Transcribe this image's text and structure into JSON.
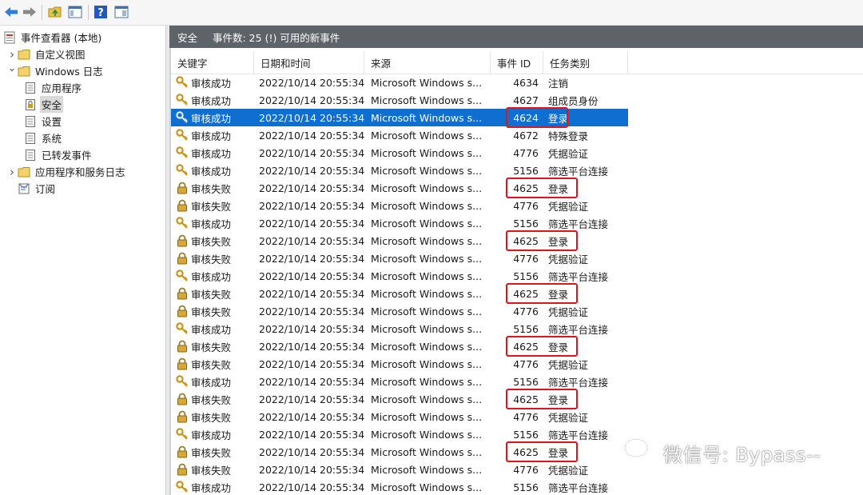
{
  "tree": {
    "root": "事件查看器 (本地)",
    "items": [
      {
        "label": "自定义视图",
        "level": 1,
        "chevron": "right"
      },
      {
        "label": "Windows 日志",
        "level": 1,
        "chevron": "down"
      },
      {
        "label": "应用程序",
        "level": 2
      },
      {
        "label": "安全",
        "level": 2,
        "selected": true
      },
      {
        "label": "设置",
        "level": 2
      },
      {
        "label": "系统",
        "level": 2
      },
      {
        "label": "已转发事件",
        "level": 2
      },
      {
        "label": "应用程序和服务日志",
        "level": 1,
        "chevron": "right"
      },
      {
        "label": "订阅",
        "level": 1
      }
    ]
  },
  "panel": {
    "title": "安全",
    "count_text": "事件数: 25 (!) 可用的新事件"
  },
  "columns": {
    "keyword": "关键字",
    "date": "日期和时间",
    "source": "来源",
    "event_id": "事件 ID",
    "task": "任务类别"
  },
  "rows": [
    {
      "kw": "审核成功",
      "icon": "key",
      "date": "2022/10/14 20:55:34",
      "src": "Microsoft Windows s...",
      "id": "4634",
      "task": "注销"
    },
    {
      "kw": "审核成功",
      "icon": "key",
      "date": "2022/10/14 20:55:34",
      "src": "Microsoft Windows s...",
      "id": "4627",
      "task": "组成员身份"
    },
    {
      "kw": "审核成功",
      "icon": "key",
      "date": "2022/10/14 20:55:34",
      "src": "Microsoft Windows s...",
      "id": "4624",
      "task": "登录",
      "selected": true,
      "highlight": true
    },
    {
      "kw": "审核成功",
      "icon": "key",
      "date": "2022/10/14 20:55:34",
      "src": "Microsoft Windows s...",
      "id": "4672",
      "task": "特殊登录"
    },
    {
      "kw": "审核成功",
      "icon": "key",
      "date": "2022/10/14 20:55:34",
      "src": "Microsoft Windows s...",
      "id": "4776",
      "task": "凭据验证"
    },
    {
      "kw": "审核成功",
      "icon": "key",
      "date": "2022/10/14 20:55:34",
      "src": "Microsoft Windows s...",
      "id": "5156",
      "task": "筛选平台连接"
    },
    {
      "kw": "审核失败",
      "icon": "lock",
      "date": "2022/10/14 20:55:34",
      "src": "Microsoft Windows s...",
      "id": "4625",
      "task": "登录",
      "highlight": true
    },
    {
      "kw": "审核失败",
      "icon": "lock",
      "date": "2022/10/14 20:55:34",
      "src": "Microsoft Windows s...",
      "id": "4776",
      "task": "凭据验证"
    },
    {
      "kw": "审核成功",
      "icon": "key",
      "date": "2022/10/14 20:55:34",
      "src": "Microsoft Windows s...",
      "id": "5156",
      "task": "筛选平台连接"
    },
    {
      "kw": "审核失败",
      "icon": "lock",
      "date": "2022/10/14 20:55:34",
      "src": "Microsoft Windows s...",
      "id": "4625",
      "task": "登录",
      "highlight": true
    },
    {
      "kw": "审核失败",
      "icon": "lock",
      "date": "2022/10/14 20:55:34",
      "src": "Microsoft Windows s...",
      "id": "4776",
      "task": "凭据验证"
    },
    {
      "kw": "审核成功",
      "icon": "key",
      "date": "2022/10/14 20:55:34",
      "src": "Microsoft Windows s...",
      "id": "5156",
      "task": "筛选平台连接"
    },
    {
      "kw": "审核失败",
      "icon": "lock",
      "date": "2022/10/14 20:55:34",
      "src": "Microsoft Windows s...",
      "id": "4625",
      "task": "登录",
      "highlight": true
    },
    {
      "kw": "审核失败",
      "icon": "lock",
      "date": "2022/10/14 20:55:34",
      "src": "Microsoft Windows s...",
      "id": "4776",
      "task": "凭据验证"
    },
    {
      "kw": "审核成功",
      "icon": "key",
      "date": "2022/10/14 20:55:34",
      "src": "Microsoft Windows s...",
      "id": "5156",
      "task": "筛选平台连接"
    },
    {
      "kw": "审核失败",
      "icon": "lock",
      "date": "2022/10/14 20:55:34",
      "src": "Microsoft Windows s...",
      "id": "4625",
      "task": "登录",
      "highlight": true
    },
    {
      "kw": "审核失败",
      "icon": "lock",
      "date": "2022/10/14 20:55:34",
      "src": "Microsoft Windows s...",
      "id": "4776",
      "task": "凭据验证"
    },
    {
      "kw": "审核成功",
      "icon": "key",
      "date": "2022/10/14 20:55:34",
      "src": "Microsoft Windows s...",
      "id": "5156",
      "task": "筛选平台连接"
    },
    {
      "kw": "审核失败",
      "icon": "lock",
      "date": "2022/10/14 20:55:34",
      "src": "Microsoft Windows s...",
      "id": "4625",
      "task": "登录",
      "highlight": true
    },
    {
      "kw": "审核失败",
      "icon": "lock",
      "date": "2022/10/14 20:55:34",
      "src": "Microsoft Windows s...",
      "id": "4776",
      "task": "凭据验证"
    },
    {
      "kw": "审核成功",
      "icon": "key",
      "date": "2022/10/14 20:55:34",
      "src": "Microsoft Windows s...",
      "id": "5156",
      "task": "筛选平台连接"
    },
    {
      "kw": "审核失败",
      "icon": "lock",
      "date": "2022/10/14 20:55:34",
      "src": "Microsoft Windows s...",
      "id": "4625",
      "task": "登录",
      "highlight": true
    },
    {
      "kw": "审核失败",
      "icon": "lock",
      "date": "2022/10/14 20:55:34",
      "src": "Microsoft Windows s...",
      "id": "4776",
      "task": "凭据验证"
    },
    {
      "kw": "审核成功",
      "icon": "key",
      "date": "2022/10/14 20:55:34",
      "src": "Microsoft Windows s...",
      "id": "5156",
      "task": "筛选平台连接"
    }
  ],
  "watermark": "微信号: Bypass--",
  "colors": {
    "header_bg": "#5d6369",
    "selection": "#0e6fd0",
    "highlight_border": "#e0141b"
  }
}
